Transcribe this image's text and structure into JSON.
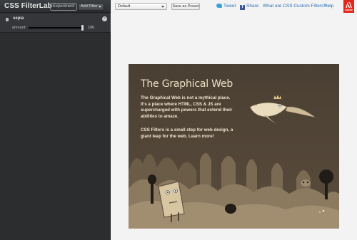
{
  "sidebar": {
    "app_title": "CSS FilterLab",
    "badge": "Experiment",
    "add_filter_label": "Add Filter",
    "filters": [
      {
        "name": "sepia",
        "param_label": "amount:",
        "param_value": "100",
        "param_fraction": 1.0
      }
    ]
  },
  "topbar": {
    "preset_selected": "Default",
    "save_preset_label": "Save as Preset",
    "tweet_label": "Tweet",
    "share_label": "Share",
    "custom_filters_link": "What are CSS Custom Filters?",
    "help_link": "Help",
    "adobe_logo_text": "Adobe"
  },
  "preview": {
    "title": "The Graphical Web",
    "paragraph1": "The Graphical Web is not a mythical place. It's a place where HTML, CSS & JS are supercharged with powers that extend their abilities to amaze.",
    "paragraph2": "CSS Filters is a small step for web design, a giant leap for the web. Learn more!"
  },
  "colors": {
    "sidebar_bg": "#2b2d2f",
    "preview_bg": "#4c4134",
    "link": "#2a6fb8",
    "adobe_red": "#e1261c"
  },
  "icons": {
    "twitter": "twitter-bird-icon",
    "facebook": "facebook-icon",
    "remove": "remove-filter-icon",
    "drag": "drag-handle-icon",
    "adobe": "adobe-logo"
  }
}
